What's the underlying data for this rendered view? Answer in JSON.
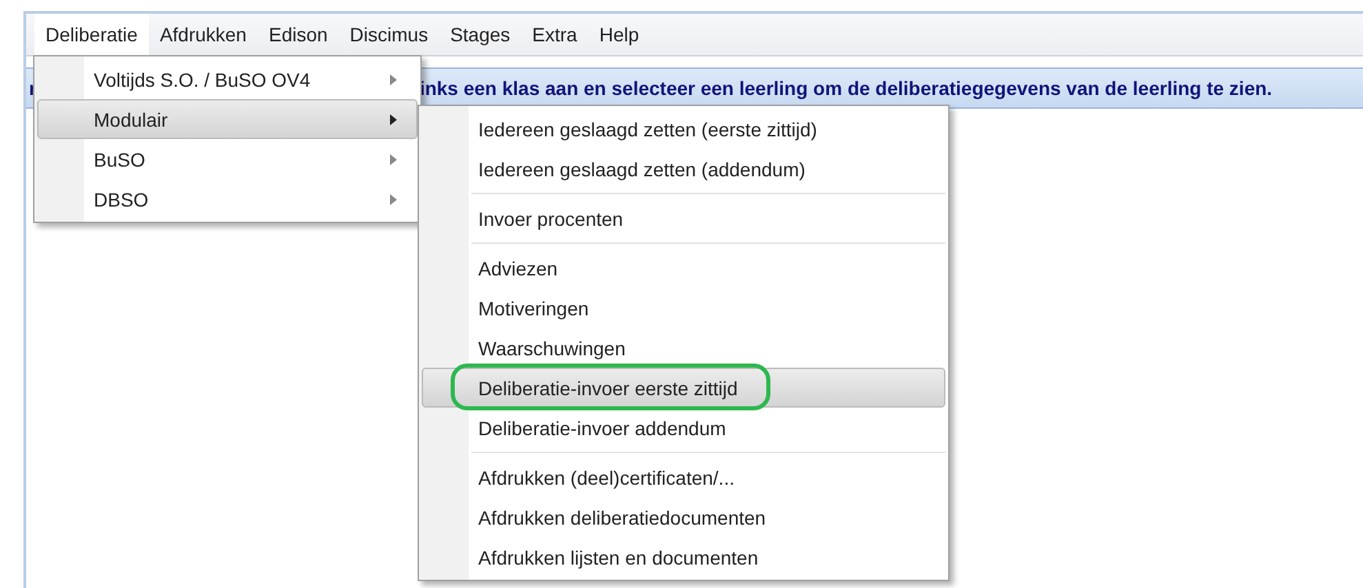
{
  "menubar": [
    {
      "label": "Deliberatie",
      "selected": true
    },
    {
      "label": "Afdrukken",
      "selected": false
    },
    {
      "label": "Edison",
      "selected": false
    },
    {
      "label": "Discimus",
      "selected": false
    },
    {
      "label": "Stages",
      "selected": false
    },
    {
      "label": "Extra",
      "selected": false
    },
    {
      "label": "Help",
      "selected": false
    }
  ],
  "banner": {
    "text_start": "r",
    "text_end": "inks een klas aan en selecteer een leerling om de deliberatiegegevens van de leerling te zien."
  },
  "menu": {
    "items": [
      {
        "label": "Voltijds S.O. / BuSO OV4",
        "selected": false,
        "submenu": true
      },
      {
        "label": "Modulair",
        "selected": true,
        "submenu": true
      },
      {
        "label": "BuSO",
        "selected": false,
        "submenu": true
      },
      {
        "label": "DBSO",
        "selected": false,
        "submenu": true
      }
    ]
  },
  "submenu": {
    "items": [
      {
        "kind": "item",
        "label": "Iedereen geslaagd zetten (eerste zittijd)",
        "selected": false,
        "annotated": false
      },
      {
        "kind": "item",
        "label": "Iedereen geslaagd zetten (addendum)",
        "selected": false,
        "annotated": false
      },
      {
        "kind": "separator"
      },
      {
        "kind": "item",
        "label": "Invoer procenten",
        "selected": false,
        "annotated": false
      },
      {
        "kind": "separator"
      },
      {
        "kind": "item",
        "label": "Adviezen",
        "selected": false,
        "annotated": false
      },
      {
        "kind": "item",
        "label": "Motiveringen",
        "selected": false,
        "annotated": false
      },
      {
        "kind": "item",
        "label": "Waarschuwingen",
        "selected": false,
        "annotated": false
      },
      {
        "kind": "item",
        "label": "Deliberatie-invoer eerste zittijd",
        "selected": true,
        "annotated": true
      },
      {
        "kind": "item",
        "label": "Deliberatie-invoer addendum",
        "selected": false,
        "annotated": false
      },
      {
        "kind": "separator"
      },
      {
        "kind": "item",
        "label": "Afdrukken (deel)certificaten/...",
        "selected": false,
        "annotated": false
      },
      {
        "kind": "item",
        "label": "Afdrukken deliberatiedocumenten",
        "selected": false,
        "annotated": false
      },
      {
        "kind": "item",
        "label": "Afdrukken lijsten en documenten",
        "selected": false,
        "annotated": false
      }
    ]
  }
}
